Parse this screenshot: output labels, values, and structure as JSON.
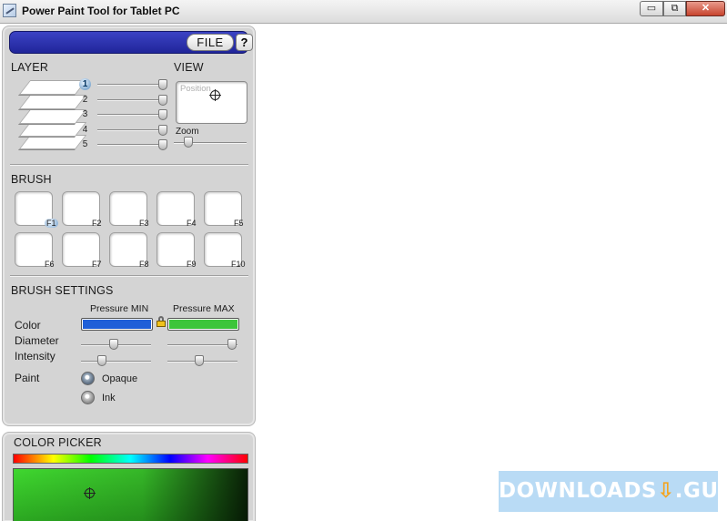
{
  "window": {
    "title": "Power Paint Tool for Tablet PC",
    "controls": {
      "minimize": "▭",
      "maximize": "⧉",
      "close": "✕"
    }
  },
  "header": {
    "file_label": "FILE",
    "help_label": "?"
  },
  "layer": {
    "title": "LAYER",
    "items": [
      {
        "label": "1",
        "selected": true,
        "slider_value": 1.0
      },
      {
        "label": "2",
        "selected": false,
        "slider_value": 1.0
      },
      {
        "label": "3",
        "selected": false,
        "slider_value": 1.0
      },
      {
        "label": "4",
        "selected": false,
        "slider_value": 1.0
      },
      {
        "label": "5",
        "selected": false,
        "slider_value": 1.0
      }
    ]
  },
  "view": {
    "title": "VIEW",
    "position_label": "Position",
    "zoom_label": "Zoom",
    "zoom_value": 0.2
  },
  "brush": {
    "title": "BRUSH",
    "slots": [
      "F1",
      "F2",
      "F3",
      "F4",
      "F5",
      "F6",
      "F7",
      "F8",
      "F9",
      "F10"
    ],
    "selected": "F1"
  },
  "brush_settings": {
    "title": "BRUSH SETTINGS",
    "pressure_min_label": "Pressure MIN",
    "pressure_max_label": "Pressure MAX",
    "color_label": "Color",
    "diameter_label": "Diameter",
    "intensity_label": "Intensity",
    "paint_label": "Paint",
    "min_color": "#1f5fd8",
    "max_color": "#3dc53a",
    "diameter_min": 0.47,
    "diameter_max": 0.92,
    "intensity_min": 0.3,
    "intensity_max": 0.45,
    "paint_options": [
      {
        "label": "Opaque",
        "selected": true
      },
      {
        "label": "Ink",
        "selected": false
      }
    ]
  },
  "color_picker": {
    "title": "COLOR PICKER"
  },
  "watermark": {
    "text": "DOWNLOADS",
    "suffix": ".GURU"
  }
}
